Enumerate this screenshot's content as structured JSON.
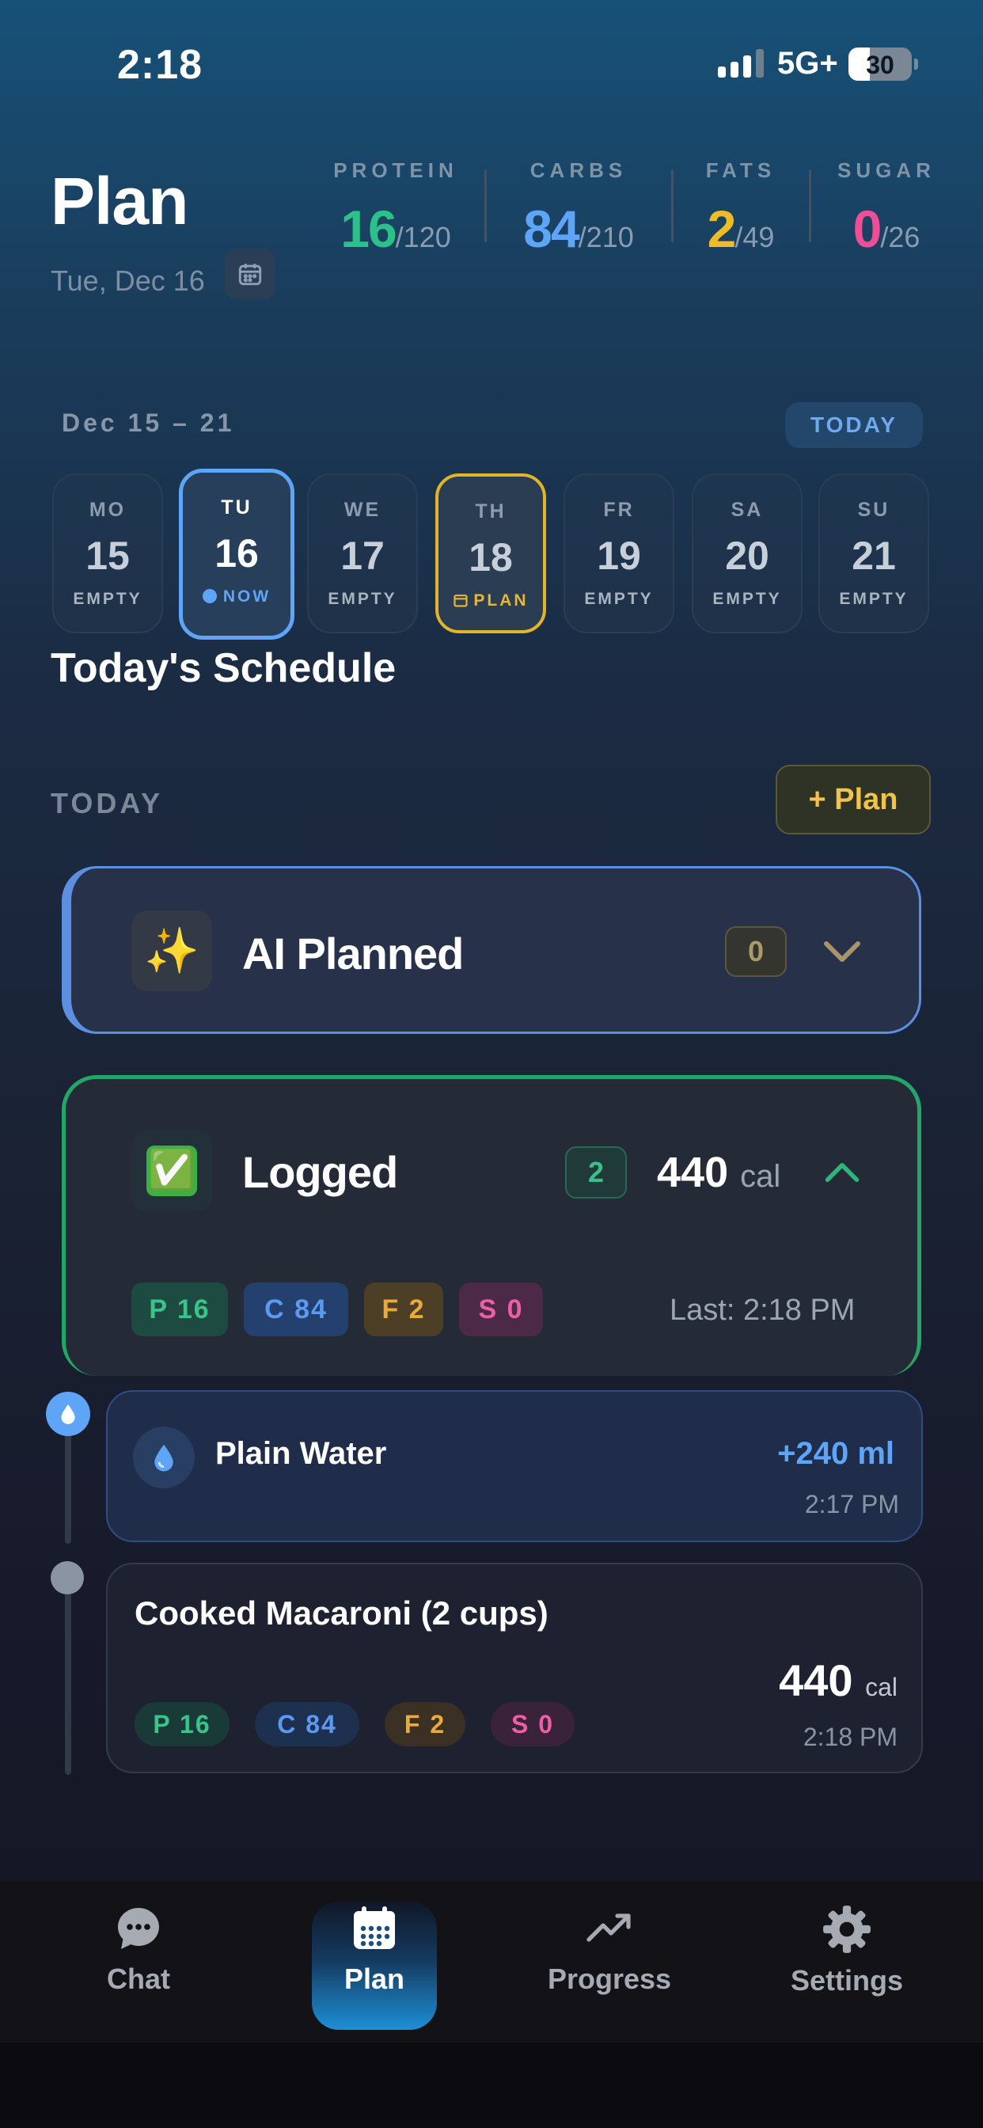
{
  "status_bar": {
    "time": "2:18",
    "network": "5G+",
    "battery": "30"
  },
  "header": {
    "title": "Plan",
    "date": "Tue, Dec 16",
    "macros": [
      {
        "label": "PROTEIN",
        "value": "16",
        "target": "/120",
        "color": "#2cc189"
      },
      {
        "label": "CARBS",
        "value": "84",
        "target": "/210",
        "color": "#5ea4f7"
      },
      {
        "label": "FATS",
        "value": "2",
        "target": "/49",
        "color": "#efbb27"
      },
      {
        "label": "SUGAR",
        "value": "0",
        "target": "/26",
        "color": "#ef4e96"
      }
    ]
  },
  "week": {
    "range": "Dec 15 – 21",
    "today_button": "TODAY",
    "days": [
      {
        "name": "MO",
        "num": "15",
        "status": "EMPTY"
      },
      {
        "name": "TU",
        "num": "16",
        "status": "NOW"
      },
      {
        "name": "WE",
        "num": "17",
        "status": "EMPTY"
      },
      {
        "name": "TH",
        "num": "18",
        "status": "PLAN"
      },
      {
        "name": "FR",
        "num": "19",
        "status": "EMPTY"
      },
      {
        "name": "SA",
        "num": "20",
        "status": "EMPTY"
      },
      {
        "name": "SU",
        "num": "21",
        "status": "EMPTY"
      }
    ]
  },
  "schedule": {
    "heading": "Today's Schedule",
    "section_label": "TODAY",
    "add_plan_button": "+ Plan",
    "ai_card": {
      "icon": "sparkles-icon",
      "emoji": "✨",
      "title": "AI Planned",
      "count": "0"
    },
    "logged_card": {
      "icon": "check-mark-button-icon",
      "emoji": "✅",
      "title": "Logged",
      "count": "2",
      "calories": "440",
      "cal_unit": "cal",
      "pills": {
        "p": "P 16",
        "c": "C 84",
        "f": "F 2",
        "s": "S 0"
      },
      "last": "Last: 2:18 PM"
    },
    "entries": [
      {
        "name": "Plain Water",
        "amount": "+240 ml",
        "time": "2:17 PM"
      },
      {
        "name": "Cooked Macaroni (2 cups)",
        "calories": "440",
        "cal_unit": "cal",
        "time": "2:18 PM",
        "pills": {
          "p": "P 16",
          "c": "C 84",
          "f": "F 2",
          "s": "S 0"
        }
      }
    ]
  },
  "tabs": [
    {
      "label": "Chat",
      "icon": "chat-bubble-icon"
    },
    {
      "label": "Plan",
      "icon": "calendar-icon",
      "active": true
    },
    {
      "label": "Progress",
      "icon": "trend-up-icon"
    },
    {
      "label": "Settings",
      "icon": "gear-icon"
    }
  ]
}
